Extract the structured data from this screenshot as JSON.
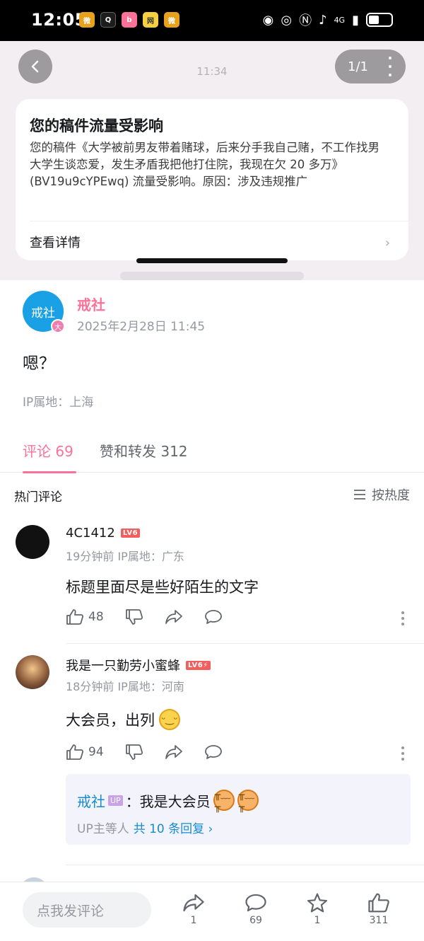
{
  "status_bar": {
    "time": "12:05",
    "network": "4G"
  },
  "overlay": {
    "time": "11:34",
    "page_indicator": "1/1",
    "notice": {
      "title": "您的稿件流量受影响",
      "body": "您的稿件《大学被前男友带着赌球，后来分手我自己赌，不工作找男大学生谈恋爱，发生矛盾我把他打住院，我现在欠 20 多万》(BV19u9cYPEwq) 流量受影响。原因：涉及违规推广",
      "link_label": "查看详情"
    }
  },
  "post": {
    "avatar_text": "戒社",
    "avatar_badge": "大",
    "author": "戒社",
    "time": "2025年2月28日 11:45",
    "content": "嗯？",
    "ip": "IP属地：上海"
  },
  "tabs": [
    {
      "label": "评论 69",
      "active": true
    },
    {
      "label": "赞和转发 312",
      "active": false
    }
  ],
  "hot": {
    "title": "热门评论",
    "sort_label": "按热度"
  },
  "comments": [
    {
      "name": "4C1412",
      "level": "LV6",
      "meta": "19分钟前 IP属地：广东",
      "text": "标题里面尽是些好陌生的文字",
      "likes": "48"
    },
    {
      "name": "我是一只勤劳小蜜蜂",
      "level": "LV6⚡",
      "meta": "18分钟前 IP属地：河南",
      "text": "大会员，出列",
      "likes": "94",
      "reply": {
        "name": "戒社",
        "tag": "UP",
        "text": "：我是大会员",
        "more_prefix": "UP主等人",
        "more_link": "共 10 条回复 ›"
      }
    }
  ],
  "bottom_bar": {
    "input_placeholder": "点我发评论",
    "share_count": "1",
    "comment_count": "69",
    "fav_count": "1",
    "like_count": "311"
  },
  "colors": {
    "accent": "#fb7299",
    "link": "#178bcf",
    "muted": "#9499a0"
  }
}
